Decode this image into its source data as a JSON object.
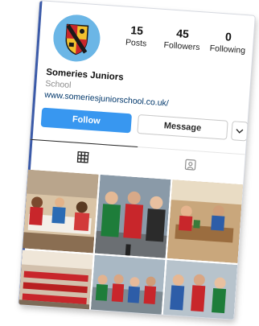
{
  "profile": {
    "name": "Someries Juniors",
    "category": "School",
    "website": "www.someriesjuniorschool.co.uk/"
  },
  "stats": {
    "posts_count": "15",
    "posts_label": "Posts",
    "followers_count": "45",
    "followers_label": "Followers",
    "following_count": "0",
    "following_label": "Following"
  },
  "actions": {
    "follow_label": "Follow",
    "message_label": "Message",
    "more_icon": "chevron-down-icon"
  },
  "tabs": [
    {
      "icon": "grid-icon",
      "active": true
    },
    {
      "icon": "tagged-icon",
      "active": false
    }
  ],
  "colors": {
    "follow_button": "#3897f0",
    "link": "#00376b",
    "avatar_background": "#6bb6e6",
    "crest_red": "#c8262b",
    "crest_yellow": "#f2c12e"
  },
  "posts": [
    {
      "name": "post-photo-party-hall"
    },
    {
      "name": "post-photo-christmas-jumpers"
    },
    {
      "name": "post-photo-classroom-kids"
    },
    {
      "name": "post-photo-dining-hall"
    },
    {
      "name": "post-photo-group-outdoor"
    },
    {
      "name": "post-photo-children-jumpers"
    }
  ]
}
